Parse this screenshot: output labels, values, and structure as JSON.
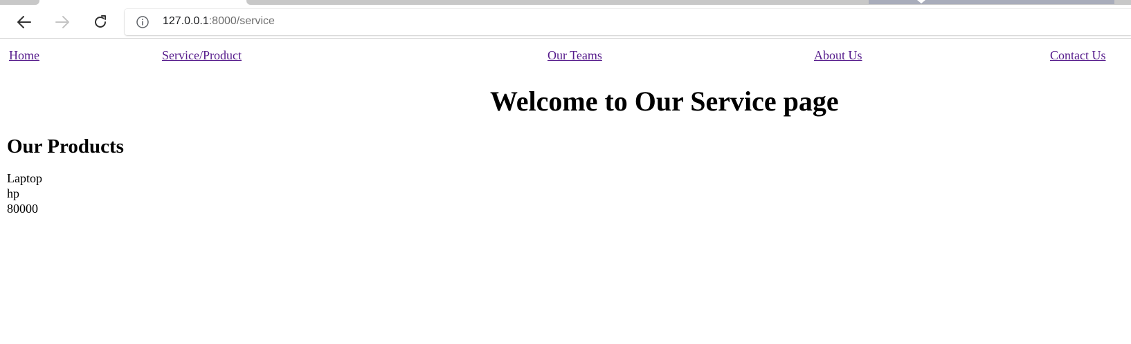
{
  "browser": {
    "url_host": "127.0.0.1",
    "url_rest": ":8000/service",
    "icons": {
      "back": "back-arrow-icon",
      "forward": "forward-arrow-icon",
      "reload": "reload-icon",
      "info": "info-icon"
    }
  },
  "nav": {
    "links": [
      {
        "label": "Home"
      },
      {
        "label": "Service/Product"
      },
      {
        "label": "Our Teams"
      },
      {
        "label": "About Us"
      },
      {
        "label": "Contact Us"
      }
    ],
    "link_color": "#551a8b"
  },
  "main": {
    "title": "Welcome to Our Service page",
    "section_heading": "Our Products",
    "product": {
      "name": "Laptop",
      "brand": "hp",
      "price": "80000"
    }
  }
}
